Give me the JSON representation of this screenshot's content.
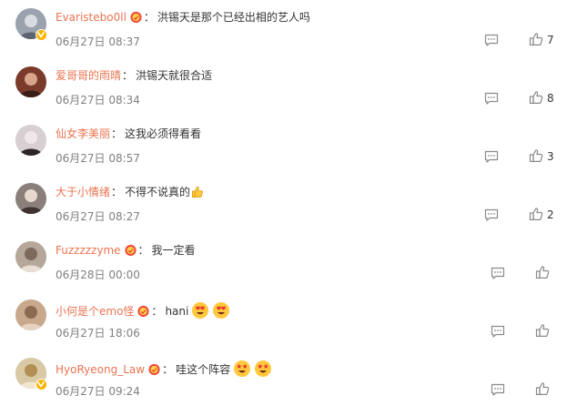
{
  "colors": {
    "username": "#eb7350",
    "text": "#333333",
    "time": "#808080",
    "icon": "#8a8a8a",
    "verified_badge": "#f7b500"
  },
  "comments": [
    {
      "user": "Evaristebo0ll",
      "sep": "：",
      "text": "洪锡天是那个已经出相的艺人吗",
      "time": "06月27日 08:37",
      "likes": "7",
      "verified": true,
      "medal": true,
      "emojis": []
    },
    {
      "user": "爱哥哥的雨晴",
      "sep": "：",
      "text": "洪锡天就很合适",
      "time": "06月27日 08:34",
      "likes": "8",
      "verified": false,
      "medal": false,
      "emojis": []
    },
    {
      "user": "仙女李美丽",
      "sep": "：",
      "text": "这我必须得看看",
      "time": "06月27日 08:57",
      "likes": "3",
      "verified": false,
      "medal": false,
      "emojis": []
    },
    {
      "user": "大于小情绪",
      "sep": "：",
      "text": "不得不说真的",
      "time": "06月27日 08:27",
      "likes": "2",
      "verified": false,
      "medal": false,
      "emojis": [
        "thumbs-up-emoji"
      ]
    },
    {
      "user": "Fuzzzzzyme",
      "sep": "：",
      "text": "我一定看",
      "time": "06月28日 00:00",
      "likes": "",
      "verified": false,
      "medal": true,
      "emojis": []
    },
    {
      "user": "小何是个emo怪",
      "sep": "：",
      "text": "hani",
      "time": "06月27日 18:06",
      "likes": "",
      "verified": false,
      "medal": true,
      "emojis": [
        "heart-eyes-emoji",
        "heart-eyes-emoji"
      ]
    },
    {
      "user": "HyoRyeong_Law",
      "sep": "：",
      "text": "哇这个阵容",
      "time": "06月27日 09:24",
      "likes": "",
      "verified": true,
      "medal": true,
      "emojis": [
        "star-struck-emoji",
        "star-struck-emoji"
      ]
    }
  ]
}
